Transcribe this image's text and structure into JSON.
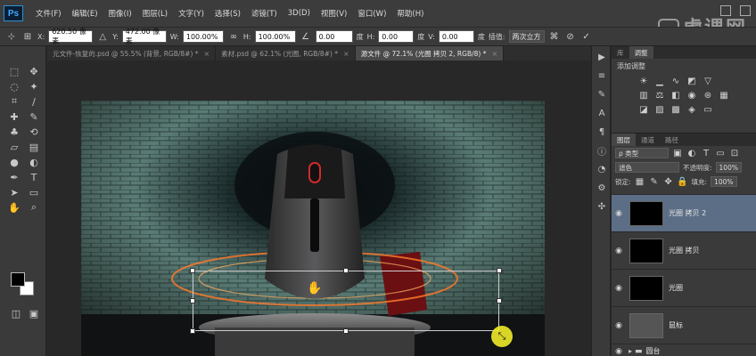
{
  "app": {
    "logo": "Ps"
  },
  "menu": [
    "文件(F)",
    "编辑(E)",
    "图像(I)",
    "图层(L)",
    "文字(Y)",
    "选择(S)",
    "滤镜(T)",
    "3D(D)",
    "视图(V)",
    "窗口(W)",
    "帮助(H)"
  ],
  "watermark": {
    "text": "虎课网"
  },
  "options": {
    "x_label": "X:",
    "x_value": "620.50 像素",
    "y_label": "Y:",
    "y_value": "472.00 像素",
    "w_label": "W:",
    "w_value": "100.00%",
    "h_label": "H:",
    "h_value": "100.00%",
    "angle_value": "0.00",
    "angle_unit": "度",
    "hskew_label": "H:",
    "hskew_value": "0.00",
    "hskew_unit": "度",
    "vskew_label": "V:",
    "vskew_value": "0.00",
    "vskew_unit": "度",
    "interp_label": "插值:",
    "interp_value": "两次立方"
  },
  "tabs": [
    {
      "label": "元文件-恢复的.psd @ 55.5% (背景, RGB/8#) *",
      "active": false
    },
    {
      "label": "素材.psd @ 62.1% (光圈, RGB/8#) *",
      "active": false
    },
    {
      "label": "源文件 @ 72.1% (光圈 拷贝 2, RGB/8) *",
      "active": true
    }
  ],
  "right_panel": {
    "top_tabs": [
      "库",
      "调整"
    ],
    "adjust_title": "添加调整",
    "layers_tabs": [
      "图层",
      "通道",
      "路径"
    ],
    "filter_kind": "ρ 类型",
    "blend_mode": "滤色",
    "opacity_label": "不透明度:",
    "opacity_value": "100%",
    "lock_label": "锁定:",
    "fill_label": "填充:",
    "fill_value": "100%",
    "layers": [
      {
        "name": "光圈 拷贝 2",
        "selected": true
      },
      {
        "name": "光圈 拷贝",
        "selected": false
      },
      {
        "name": "光圈",
        "selected": false
      },
      {
        "name": "鼠标",
        "selected": false
      },
      {
        "name": "圆台",
        "selected": false
      }
    ]
  },
  "colors": {
    "selection": "#5c6e86",
    "ps_blue": "#3fa7ff",
    "cursor_yellow": "#f0eb28"
  }
}
